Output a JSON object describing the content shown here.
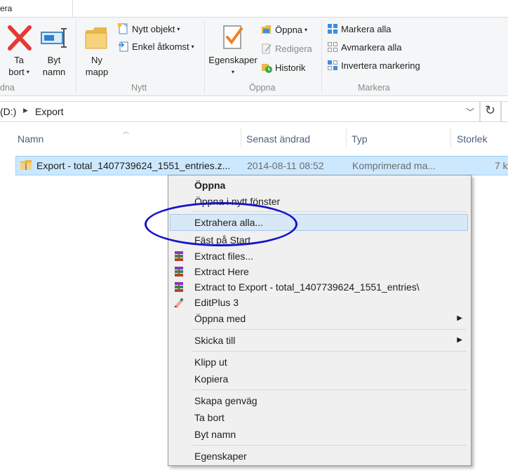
{
  "ribbon_tab_fragment": "era",
  "ribbon": {
    "groups": [
      {
        "label": "dna"
      },
      {
        "label": "Nytt"
      },
      {
        "label": "Öppna"
      },
      {
        "label": "Markera"
      }
    ],
    "delete_label_1": "Ta",
    "delete_label_2": "bort",
    "rename_label_1": "Byt",
    "rename_label_2": "namn",
    "newfolder_label_1": "Ny",
    "newfolder_label_2": "mapp",
    "new_item": "Nytt objekt",
    "easy_access": "Enkel åtkomst",
    "properties_label": "Egenskaper",
    "open": "Öppna",
    "edit": "Redigera",
    "history": "Historik",
    "select_all": "Markera alla",
    "select_none": "Avmarkera alla",
    "invert_selection": "Invertera markering"
  },
  "address": {
    "drive": "(D:)",
    "folder": "Export"
  },
  "columns": [
    {
      "label": "Namn"
    },
    {
      "label": "Senast ändrad"
    },
    {
      "label": "Typ"
    },
    {
      "label": "Storlek"
    }
  ],
  "file": {
    "name": "Export - total_1407739624_1551_entries.z...",
    "date": "2014-08-11 08:52",
    "type": "Komprimerad ma...",
    "size": "7 k"
  },
  "menu": {
    "items": [
      {
        "label": "Öppna"
      },
      {
        "label": "Öppna i nytt fönster"
      },
      {
        "label": "Extrahera alla..."
      },
      {
        "label": "Fäst på Start"
      },
      {
        "label": "Extract files..."
      },
      {
        "label": "Extract Here"
      },
      {
        "label": "Extract to Export - total_1407739624_1551_entries\\"
      },
      {
        "label": "EditPlus 3"
      },
      {
        "label": "Öppna med"
      },
      {
        "label": "Skicka till"
      },
      {
        "label": "Klipp ut"
      },
      {
        "label": "Kopiera"
      },
      {
        "label": "Skapa genväg"
      },
      {
        "label": "Ta bort"
      },
      {
        "label": "Byt namn"
      },
      {
        "label": "Egenskaper"
      }
    ]
  },
  "colors": {
    "selection": "#cce8ff",
    "annotation": "#1414c8",
    "menu_bg": "#f0f0f0"
  }
}
